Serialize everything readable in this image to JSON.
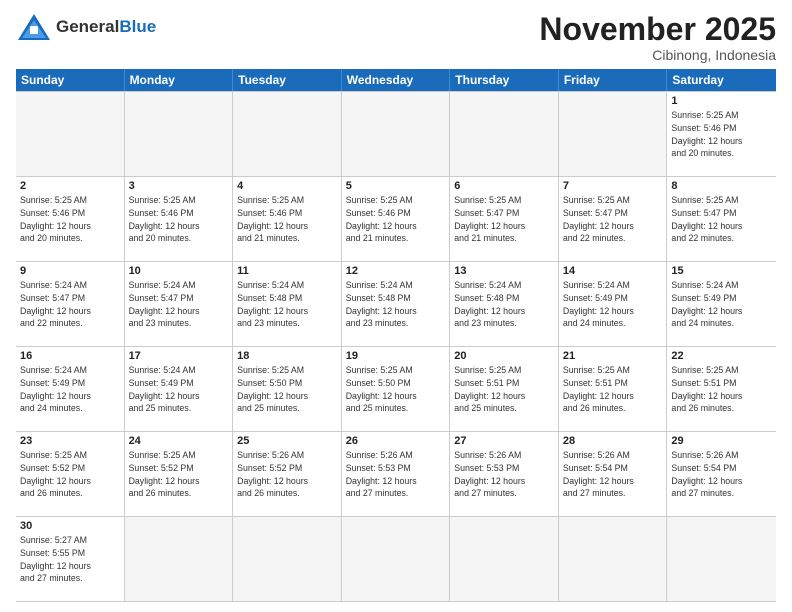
{
  "header": {
    "logo_general": "General",
    "logo_blue": "Blue",
    "month_title": "November 2025",
    "location": "Cibinong, Indonesia"
  },
  "weekdays": [
    "Sunday",
    "Monday",
    "Tuesday",
    "Wednesday",
    "Thursday",
    "Friday",
    "Saturday"
  ],
  "cells": [
    {
      "day": "",
      "info": "",
      "empty": true
    },
    {
      "day": "",
      "info": "",
      "empty": true
    },
    {
      "day": "",
      "info": "",
      "empty": true
    },
    {
      "day": "",
      "info": "",
      "empty": true
    },
    {
      "day": "",
      "info": "",
      "empty": true
    },
    {
      "day": "",
      "info": "",
      "empty": true
    },
    {
      "day": "1",
      "info": "Sunrise: 5:25 AM\nSunset: 5:46 PM\nDaylight: 12 hours\nand 20 minutes."
    },
    {
      "day": "2",
      "info": "Sunrise: 5:25 AM\nSunset: 5:46 PM\nDaylight: 12 hours\nand 20 minutes."
    },
    {
      "day": "3",
      "info": "Sunrise: 5:25 AM\nSunset: 5:46 PM\nDaylight: 12 hours\nand 20 minutes."
    },
    {
      "day": "4",
      "info": "Sunrise: 5:25 AM\nSunset: 5:46 PM\nDaylight: 12 hours\nand 21 minutes."
    },
    {
      "day": "5",
      "info": "Sunrise: 5:25 AM\nSunset: 5:46 PM\nDaylight: 12 hours\nand 21 minutes."
    },
    {
      "day": "6",
      "info": "Sunrise: 5:25 AM\nSunset: 5:47 PM\nDaylight: 12 hours\nand 21 minutes."
    },
    {
      "day": "7",
      "info": "Sunrise: 5:25 AM\nSunset: 5:47 PM\nDaylight: 12 hours\nand 22 minutes."
    },
    {
      "day": "8",
      "info": "Sunrise: 5:25 AM\nSunset: 5:47 PM\nDaylight: 12 hours\nand 22 minutes."
    },
    {
      "day": "9",
      "info": "Sunrise: 5:24 AM\nSunset: 5:47 PM\nDaylight: 12 hours\nand 22 minutes."
    },
    {
      "day": "10",
      "info": "Sunrise: 5:24 AM\nSunset: 5:47 PM\nDaylight: 12 hours\nand 23 minutes."
    },
    {
      "day": "11",
      "info": "Sunrise: 5:24 AM\nSunset: 5:48 PM\nDaylight: 12 hours\nand 23 minutes."
    },
    {
      "day": "12",
      "info": "Sunrise: 5:24 AM\nSunset: 5:48 PM\nDaylight: 12 hours\nand 23 minutes."
    },
    {
      "day": "13",
      "info": "Sunrise: 5:24 AM\nSunset: 5:48 PM\nDaylight: 12 hours\nand 23 minutes."
    },
    {
      "day": "14",
      "info": "Sunrise: 5:24 AM\nSunset: 5:49 PM\nDaylight: 12 hours\nand 24 minutes."
    },
    {
      "day": "15",
      "info": "Sunrise: 5:24 AM\nSunset: 5:49 PM\nDaylight: 12 hours\nand 24 minutes."
    },
    {
      "day": "16",
      "info": "Sunrise: 5:24 AM\nSunset: 5:49 PM\nDaylight: 12 hours\nand 24 minutes."
    },
    {
      "day": "17",
      "info": "Sunrise: 5:24 AM\nSunset: 5:49 PM\nDaylight: 12 hours\nand 25 minutes."
    },
    {
      "day": "18",
      "info": "Sunrise: 5:25 AM\nSunset: 5:50 PM\nDaylight: 12 hours\nand 25 minutes."
    },
    {
      "day": "19",
      "info": "Sunrise: 5:25 AM\nSunset: 5:50 PM\nDaylight: 12 hours\nand 25 minutes."
    },
    {
      "day": "20",
      "info": "Sunrise: 5:25 AM\nSunset: 5:51 PM\nDaylight: 12 hours\nand 25 minutes."
    },
    {
      "day": "21",
      "info": "Sunrise: 5:25 AM\nSunset: 5:51 PM\nDaylight: 12 hours\nand 26 minutes."
    },
    {
      "day": "22",
      "info": "Sunrise: 5:25 AM\nSunset: 5:51 PM\nDaylight: 12 hours\nand 26 minutes."
    },
    {
      "day": "23",
      "info": "Sunrise: 5:25 AM\nSunset: 5:52 PM\nDaylight: 12 hours\nand 26 minutes."
    },
    {
      "day": "24",
      "info": "Sunrise: 5:25 AM\nSunset: 5:52 PM\nDaylight: 12 hours\nand 26 minutes."
    },
    {
      "day": "25",
      "info": "Sunrise: 5:26 AM\nSunset: 5:52 PM\nDaylight: 12 hours\nand 26 minutes."
    },
    {
      "day": "26",
      "info": "Sunrise: 5:26 AM\nSunset: 5:53 PM\nDaylight: 12 hours\nand 27 minutes."
    },
    {
      "day": "27",
      "info": "Sunrise: 5:26 AM\nSunset: 5:53 PM\nDaylight: 12 hours\nand 27 minutes."
    },
    {
      "day": "28",
      "info": "Sunrise: 5:26 AM\nSunset: 5:54 PM\nDaylight: 12 hours\nand 27 minutes."
    },
    {
      "day": "29",
      "info": "Sunrise: 5:26 AM\nSunset: 5:54 PM\nDaylight: 12 hours\nand 27 minutes."
    },
    {
      "day": "30",
      "info": "Sunrise: 5:27 AM\nSunset: 5:55 PM\nDaylight: 12 hours\nand 27 minutes."
    },
    {
      "day": "",
      "info": "",
      "empty": true
    },
    {
      "day": "",
      "info": "",
      "empty": true
    },
    {
      "day": "",
      "info": "",
      "empty": true
    },
    {
      "day": "",
      "info": "",
      "empty": true
    },
    {
      "day": "",
      "info": "",
      "empty": true
    },
    {
      "day": "",
      "info": "",
      "empty": true
    }
  ]
}
